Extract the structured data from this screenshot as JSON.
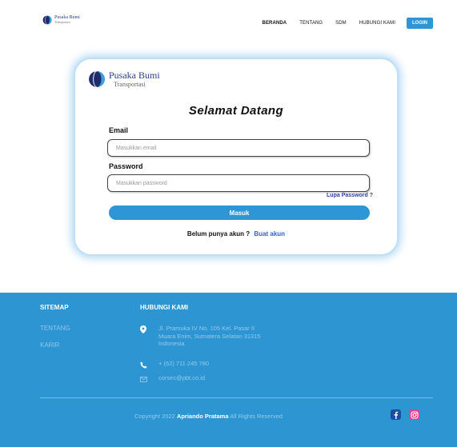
{
  "header": {
    "logo_name": "Pusaka Bumi",
    "logo_sub": "Transportasi",
    "nav": [
      "BERANDA",
      "TENTANG",
      "SDM",
      "HUBUNGI KAMI"
    ],
    "login_label": "LOGIN"
  },
  "card": {
    "logo_name": "Pusaka Bumi",
    "logo_sub": "Transportasi",
    "welcome": "Selamat Datang",
    "email_label": "Email",
    "email_placeholder": "Masukkan email",
    "password_label": "Password",
    "password_placeholder": "Masukkan password",
    "forgot_label": "Lupa Password ?",
    "submit_label": "Masuk",
    "signup_prompt": "Belum punya akun ?",
    "signup_link": "Buat akun"
  },
  "footer": {
    "sitemap_title": "SITEMAP",
    "sitemap_links": [
      "TENTANG",
      "KARIR"
    ],
    "contact_title": "HUBUNGI KAMI",
    "address_line1": "Jl. Pramuka IV No. 105 Kel. Pasar II",
    "address_line2": "Muara Enim, Sumatera Selatan 31315",
    "address_line3": "Indonesia",
    "phone": "+ (62) 711 245 780",
    "email": "corsec@pbt.co.id",
    "copyright_prefix": "Copyright 2022",
    "copyright_name": "Apriando Pratama",
    "copyright_suffix": "All Rights Reserved"
  },
  "colors": {
    "primary": "#2f96d6",
    "footer_bg": "#2e95d3",
    "link": "#2f5ed6"
  },
  "icons": [
    "globe-logo-icon",
    "location-pin-icon",
    "phone-icon",
    "mail-icon",
    "facebook-icon",
    "instagram-icon"
  ]
}
